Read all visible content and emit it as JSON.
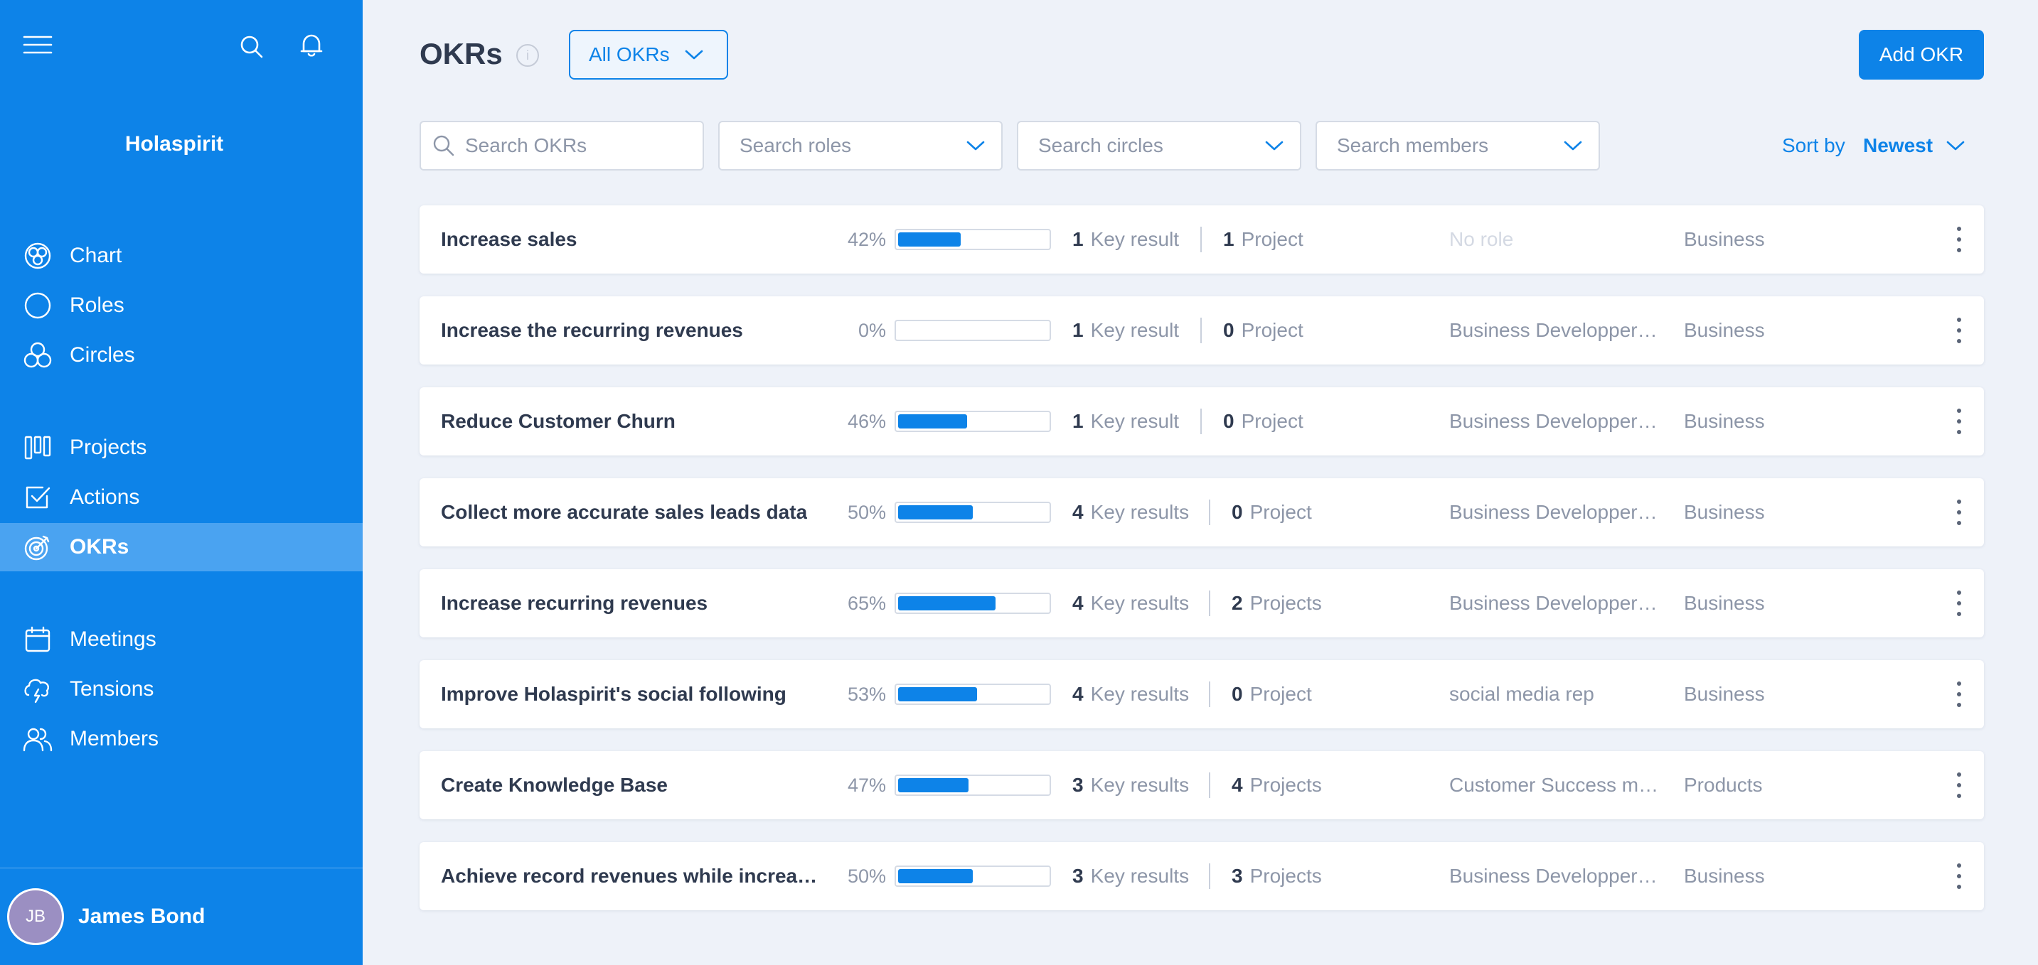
{
  "sidebar": {
    "brand": "Holaspirit",
    "nav": [
      {
        "label": "Chart",
        "icon": "chart-icon",
        "active": false
      },
      {
        "label": "Roles",
        "icon": "roles-icon",
        "active": false
      },
      {
        "label": "Circles",
        "icon": "circles-icon",
        "active": false
      },
      {
        "label": "Projects",
        "icon": "projects-icon",
        "active": false
      },
      {
        "label": "Actions",
        "icon": "actions-icon",
        "active": false
      },
      {
        "label": "OKRs",
        "icon": "okrs-icon",
        "active": true
      },
      {
        "label": "Meetings",
        "icon": "meetings-icon",
        "active": false
      },
      {
        "label": "Tensions",
        "icon": "tensions-icon",
        "active": false
      },
      {
        "label": "Members",
        "icon": "members-icon",
        "active": false
      }
    ],
    "user": {
      "initials": "JB",
      "name": "James Bond"
    }
  },
  "header": {
    "title": "OKRs",
    "filter": "All OKRs",
    "add_button": "Add OKR"
  },
  "filters": {
    "search_okrs_placeholder": "Search OKRs",
    "roles": "Search roles",
    "circles": "Search circles",
    "members": "Search members",
    "sort_label": "Sort by",
    "sort_value": "Newest"
  },
  "colors": {
    "accent": "#0d83e8",
    "active_nav": "#4aa3f1"
  },
  "okrs": [
    {
      "name": "Increase sales",
      "progress": "42%",
      "kr_count": "1",
      "kr_label": "Key result",
      "project_count": "1",
      "project_label": "Project",
      "role": "No role",
      "circle": "Business"
    },
    {
      "name": "Increase the recurring revenues",
      "progress": "0%",
      "kr_count": "1",
      "kr_label": "Key result",
      "project_count": "0",
      "project_label": "Project",
      "role": "Business Developper I...",
      "circle": "Business"
    },
    {
      "name": "Reduce Customer Churn",
      "progress": "46%",
      "kr_count": "1",
      "kr_label": "Key result",
      "project_count": "0",
      "project_label": "Project",
      "role": "Business Developper I...",
      "circle": "Business"
    },
    {
      "name": "Collect more accurate sales leads data",
      "progress": "50%",
      "kr_count": "4",
      "kr_label": "Key results",
      "project_count": "0",
      "project_label": "Project",
      "role": "Business Developper I...",
      "circle": "Business"
    },
    {
      "name": "Increase recurring revenues",
      "progress": "65%",
      "kr_count": "4",
      "kr_label": "Key results",
      "project_count": "2",
      "project_label": "Projects",
      "role": "Business Developper I...",
      "circle": "Business"
    },
    {
      "name": "Improve Holaspirit's social following",
      "progress": "53%",
      "kr_count": "4",
      "kr_label": "Key results",
      "project_count": "0",
      "project_label": "Project",
      "role": "social media rep",
      "circle": "Business"
    },
    {
      "name": "Create Knowledge Base",
      "progress": "47%",
      "kr_count": "3",
      "kr_label": "Key results",
      "project_count": "4",
      "project_label": "Projects",
      "role": "Customer Success ma...",
      "circle": "Products"
    },
    {
      "name": "Achieve record revenues while increasin...",
      "progress": "50%",
      "kr_count": "3",
      "kr_label": "Key results",
      "project_count": "3",
      "project_label": "Projects",
      "role": "Business Developper I...",
      "circle": "Business"
    }
  ]
}
